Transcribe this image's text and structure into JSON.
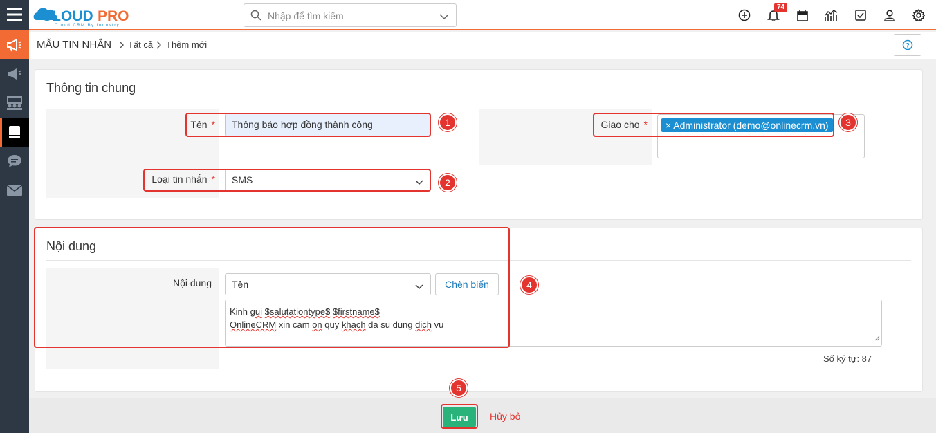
{
  "app": {
    "logo_text": "CLOUDPRO",
    "logo_tagline": "Cloud CRM By Industry"
  },
  "topbar": {
    "search_placeholder": "Nhập để tìm kiếm",
    "notification_count": "74",
    "icons": [
      "plus-circle-icon",
      "bell-icon",
      "calendar-icon",
      "chart-icon",
      "checkbox-icon",
      "user-icon",
      "gear-icon"
    ]
  },
  "sidebar": {
    "items": [
      "megaphone-icon",
      "megaphone-icon",
      "users-board-icon",
      "document-icon",
      "chat-icon",
      "envelope-icon"
    ]
  },
  "breadcrumb": {
    "module": "MẪU TIN NHẮN",
    "level1": "Tất cả",
    "level2": "Thêm mới"
  },
  "general": {
    "title": "Thông tin chung",
    "name_label": "Tên",
    "name_value": "Thông báo hợp đồng thành công",
    "type_label": "Loại tin nhắn",
    "type_value": "SMS",
    "assign_label": "Giao cho",
    "assign_tag": "Administrator (demo@onlinecrm.vn)",
    "required_mark": "*"
  },
  "content": {
    "title": "Nội dung",
    "content_label": "Nội dung",
    "variable_select": "Tên",
    "insert_button": "Chèn biến",
    "body_parts": {
      "l1a": "Kinh ",
      "l1b": "gui",
      "l1c": " ",
      "l1d": "$salutationtype$",
      "l1e": " ",
      "l1f": "$firstname$",
      "l2a": "OnlineCRM",
      "l2b": " xin cam ",
      "l2c": "on",
      "l2d": " quy ",
      "l2e": "khach",
      "l2f": " da su dung ",
      "l2g": "dich",
      "l2h": " vu"
    },
    "char_count": "Số ký tự: 87"
  },
  "footer": {
    "save_label": "Lưu",
    "cancel_label": "Hủy bỏ"
  },
  "annotations": [
    "1",
    "2",
    "3",
    "4",
    "5"
  ],
  "colors": {
    "accent": "#f26b35",
    "sidebar": "#2e3845",
    "tag": "#1b8fd1",
    "save": "#2ab27b",
    "highlight": "#e3342f"
  }
}
